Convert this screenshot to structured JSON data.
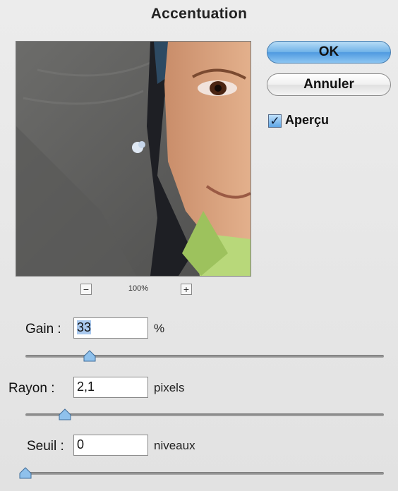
{
  "dialog": {
    "title": "Accentuation"
  },
  "buttons": {
    "ok_label": "OK",
    "cancel_label": "Annuler"
  },
  "preview_option": {
    "label": "Aperçu",
    "checked": true
  },
  "zoom": {
    "minus": "−",
    "level": "100%",
    "plus": "+"
  },
  "params": [
    {
      "label": "Gain :",
      "value": "33",
      "unit": "%",
      "slider_fraction": 0.18
    },
    {
      "label": "Rayon :",
      "value": "2,1",
      "unit": "pixels",
      "slider_fraction": 0.11
    },
    {
      "label": "Seuil :",
      "value": "0",
      "unit": "niveaux",
      "slider_fraction": 0.0
    }
  ],
  "colors": {
    "ok_button": "#6fb2e8",
    "slider_thumb": "#8fc1ec"
  }
}
